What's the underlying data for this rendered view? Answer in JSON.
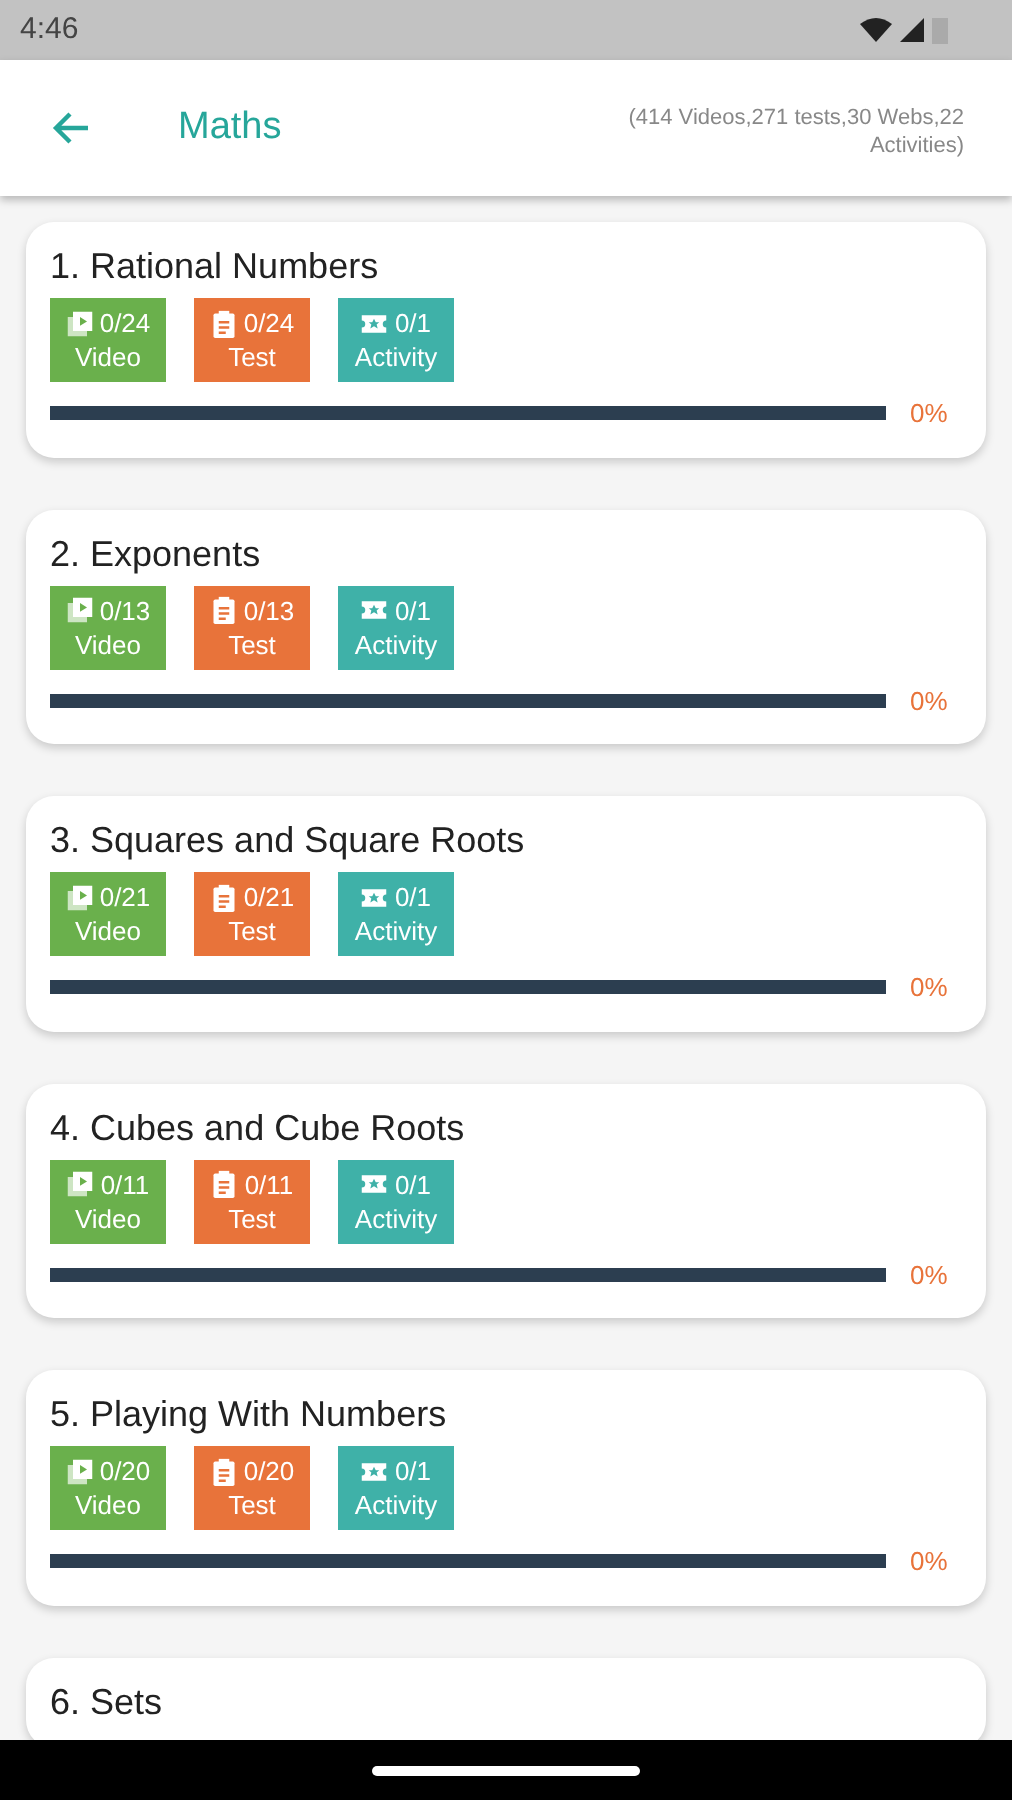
{
  "status_bar": {
    "time": "4:46"
  },
  "header": {
    "title": "Maths",
    "summary": "(414 Videos,271 tests,30 Webs,22 Activities)"
  },
  "chapters": [
    {
      "title": "1. Rational Numbers",
      "badges": [
        {
          "kind": "video",
          "count": "0/24",
          "label": "Video"
        },
        {
          "kind": "test",
          "count": "0/24",
          "label": "Test"
        },
        {
          "kind": "activity",
          "count": "0/1",
          "label": "Activity"
        }
      ],
      "level": 0,
      "percent": "0%"
    },
    {
      "title": "2. Exponents",
      "badges": [
        {
          "kind": "video",
          "count": "0/13",
          "label": "Video"
        },
        {
          "kind": "test",
          "count": "0/13",
          "label": "Test"
        },
        {
          "kind": "activity",
          "count": "0/1",
          "label": "Activity"
        }
      ],
      "level": 0,
      "percent": "0%"
    },
    {
      "title": "3. Squares and Square Roots",
      "badges": [
        {
          "kind": "video",
          "count": "0/21",
          "label": "Video"
        },
        {
          "kind": "test",
          "count": "0/21",
          "label": "Test"
        },
        {
          "kind": "activity",
          "count": "0/1",
          "label": "Activity"
        }
      ],
      "level": 0,
      "percent": "0%"
    },
    {
      "title": "4. Cubes and Cube Roots",
      "badges": [
        {
          "kind": "video",
          "count": "0/11",
          "label": "Video"
        },
        {
          "kind": "test",
          "count": "0/11",
          "label": "Test"
        },
        {
          "kind": "activity",
          "count": "0/1",
          "label": "Activity"
        }
      ],
      "level": 0,
      "percent": "0%"
    },
    {
      "title": "5. Playing With Numbers",
      "badges": [
        {
          "kind": "video",
          "count": "0/20",
          "label": "Video"
        },
        {
          "kind": "test",
          "count": "0/20",
          "label": "Test"
        },
        {
          "kind": "activity",
          "count": "0/1",
          "label": "Activity"
        }
      ],
      "level": 0,
      "percent": "0%"
    },
    {
      "title": "6. Sets"
    }
  ]
}
